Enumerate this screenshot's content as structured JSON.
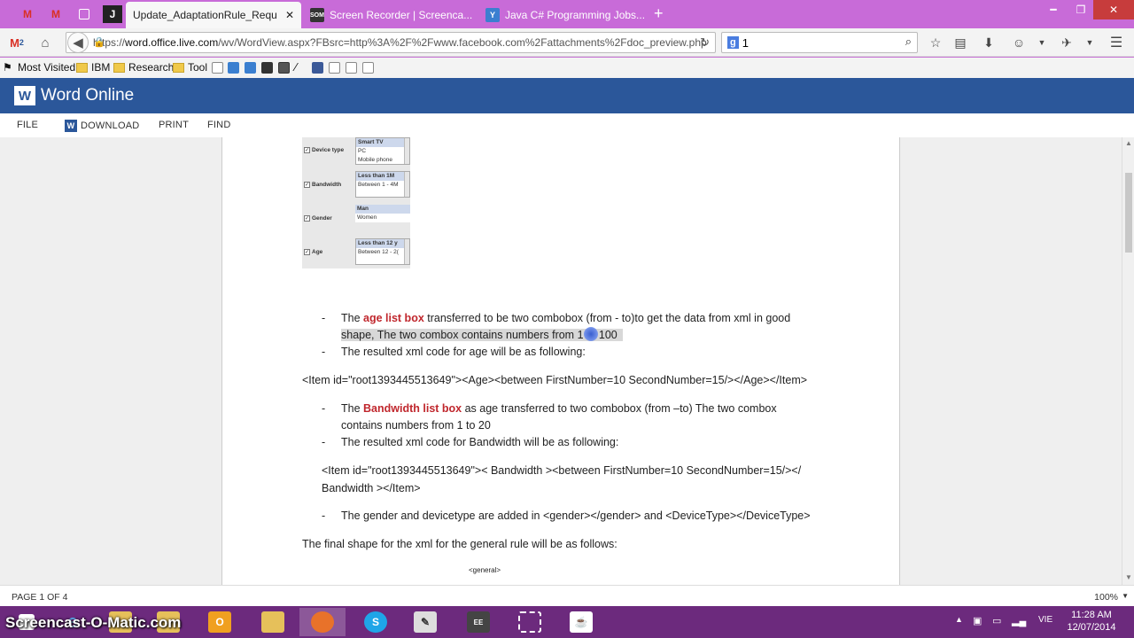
{
  "browser": {
    "tabs": [
      {
        "label": "Update_AdaptationRule_Requir...",
        "active": true
      },
      {
        "label": "Screen Recorder | Screenca...",
        "active": false
      },
      {
        "label": "Java C# Programming Jobs...",
        "active": false
      }
    ],
    "url_prefix": "https://",
    "url_host": "word.office.live.com",
    "url_path": "/wv/WordView.aspx?FBsrc=http%3A%2F%2Fwww.facebook.com%2Fattachments%2Fdoc_preview.php",
    "search_value": "1",
    "gmail_badge": "2"
  },
  "bookmarks": [
    {
      "label": "Most Visited"
    },
    {
      "label": "IBM"
    },
    {
      "label": "Research"
    },
    {
      "label": "Tool"
    }
  ],
  "app": {
    "title": "Word Online",
    "logo_letter": "W"
  },
  "ribbon": {
    "file": "FILE",
    "download": "DOWNLOAD",
    "print": "PRINT",
    "find": "FIND"
  },
  "figure": {
    "rows": [
      {
        "label": "Device type",
        "items": [
          "Smart TV",
          "PC",
          "Mobile phone"
        ]
      },
      {
        "label": "Bandwidth",
        "items": [
          "Less than 1M",
          "Between 1 - 4M"
        ]
      },
      {
        "label": "Gender",
        "items": [
          "Man",
          "Women"
        ]
      },
      {
        "label": "Age",
        "items": [
          "Less than 12 y",
          "Between 12 - 2("
        ]
      }
    ]
  },
  "doc": {
    "b1_pre": "The ",
    "b1_red": "age list box",
    "b1_post": " transferred to be two combobox (from -  to)to get the data from xml in good",
    "b1_line2": "shape, The two combox contains numbers from 1 to 100",
    "b2": "The resulted xml code for age will be as following:",
    "xml_age": "<Item id=\"root1393445513649\"><Age><between  FirstNumber=10  SecondNumber=15/></Age></Item>",
    "b3_pre": "The ",
    "b3_red": "Bandwidth list box",
    "b3_post": " as age transferred to two combobox (from –to) The two combox",
    "b3_line2": "contains numbers from 1 to 20",
    "b4": "The resulted xml code for Bandwidth will be as following:",
    "xml_bw_1": "<Item id=\"root1393445513649\"><   Bandwidth ><between FirstNumber=10  SecondNumber=15/></",
    "xml_bw_2": "Bandwidth ></Item>",
    "b5": "The gender and devicetype are added in <gender></gender> and <DeviceType></DeviceType>",
    "final": "The final shape for the xml for the general rule will be as follows:",
    "code1": "<general>",
    "dash": "-"
  },
  "status": {
    "page": "PAGE 1 OF 4",
    "zoom": "100%"
  },
  "taskbar": {
    "watermark": "Screencast-O-Matic.com",
    "lang": "VIE",
    "time": "11:28 AM",
    "date": "12/07/2014"
  },
  "colors": {
    "tabstrip": "#c86bd8",
    "word_blue": "#2b579a",
    "taskbar": "#6c2a7d",
    "highlight_red": "#c0272d"
  }
}
